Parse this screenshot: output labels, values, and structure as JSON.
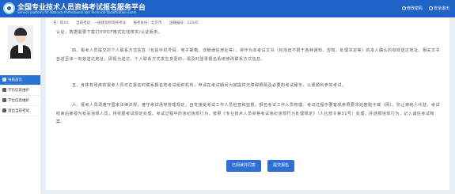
{
  "header": {
    "title": "全国专业技术人员资格考试报名服务平台",
    "subtitle": "Service platform for National Professional and Technical Qualification Exam",
    "links": [
      {
        "label": "修改密码",
        "icon": "lock-icon"
      },
      {
        "label": "安全退出",
        "icon": "power-icon"
      }
    ]
  },
  "info_bar": {
    "name": "名：陈XX",
    "exam": "当前考试：一级建造师资格考试",
    "city": "报考省份：北京市",
    "id": "国籍编号：12345"
  },
  "sidebar": {
    "items": [
      {
        "label": "导航首页",
        "icon": "home-icon"
      },
      {
        "label": "学历信息维护",
        "icon": "edit-icon"
      },
      {
        "label": "学位信息维护",
        "icon": "edit-icon"
      },
      {
        "label": "退出当前考试",
        "icon": "exit-icon"
      }
    ]
  },
  "content": {
    "paragraphs": [
      "认证，数据需要下载打印PDF格式在线核实/认证服务。",
      "四、报考人员提交的个人联系方式信息（包括手机号码、电子邮箱、详细通信地址等），将作为本考试文书（包括但不限于各种通知、告知、处理决定等）的本人确认的有效送达地址。相关文书自送至该一有效送达地址，即视为送达。个人联系方式发生变更的，需及时登录报名系统修改联系方式信息。",
      "五、身体有残疾的报考人员可在报名时联系报名地考试组织机构，申请在考试期间为其提供无障碍照顾及必要的考试服务，以便顺利参加考试。",
      "六、报考人员须遵守国家法律法规，遵守考试场地管理规定，自觉接受考试工作人员检查和监督。报名考试工作人员管理。考试过程中要客观参照要求的答题卡或（网）。防止被他人代替，考试结束后被视为有关违规人员，将依据考试规定处理。考试过程中的违纪违规行为，按照《专业技术人员资格考试违纪违规行为处理规定》（人社部令第31号）处理，并通报违规行为，记入诚信考试档案。"
    ]
  },
  "buttons": {
    "read_label": "已阅读并同意",
    "submit_label": "提交报名"
  },
  "colors": {
    "brand": "#1f63c6",
    "active_nav": "#2a72d4",
    "button": "#2f6fd1"
  }
}
